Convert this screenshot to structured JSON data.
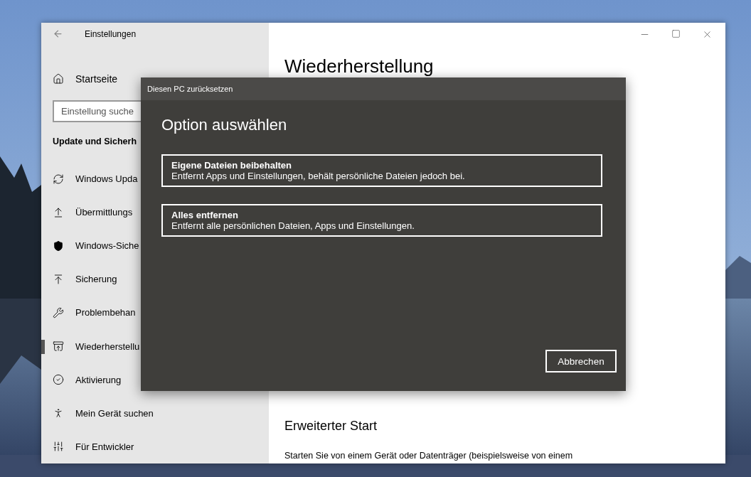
{
  "window": {
    "title": "Einstellungen"
  },
  "sidebar": {
    "home": "Startseite",
    "search": {
      "placeholder": "Einstellung suche"
    },
    "section": "Update und Sicherh",
    "items": [
      {
        "label": "Windows Upda",
        "selected": false
      },
      {
        "label": "Übermittlungs",
        "selected": false
      },
      {
        "label": "Windows-Siche",
        "selected": false
      },
      {
        "label": "Sicherung",
        "selected": false
      },
      {
        "label": "Problembehan",
        "selected": false
      },
      {
        "label": "Wiederherstellu",
        "selected": true
      },
      {
        "label": "Aktivierung",
        "selected": false
      },
      {
        "label": "Mein Gerät suchen",
        "selected": false
      },
      {
        "label": "Für Entwickler",
        "selected": false
      }
    ]
  },
  "content": {
    "heading": "Wiederherstellung",
    "subheading": "Erweiterter Start",
    "text": "Starten Sie von einem Gerät oder Datenträger (beispielsweise von einem"
  },
  "dialog": {
    "title": "Diesen PC zurücksetzen",
    "heading": "Option auswählen",
    "options": [
      {
        "title": "Eigene Dateien beibehalten",
        "description": "Entfernt Apps und Einstellungen, behält persönliche Dateien jedoch bei."
      },
      {
        "title": "Alles entfernen",
        "description": "Entfernt alle persönlichen Dateien, Apps und Einstellungen."
      }
    ],
    "cancel": "Abbrechen"
  }
}
